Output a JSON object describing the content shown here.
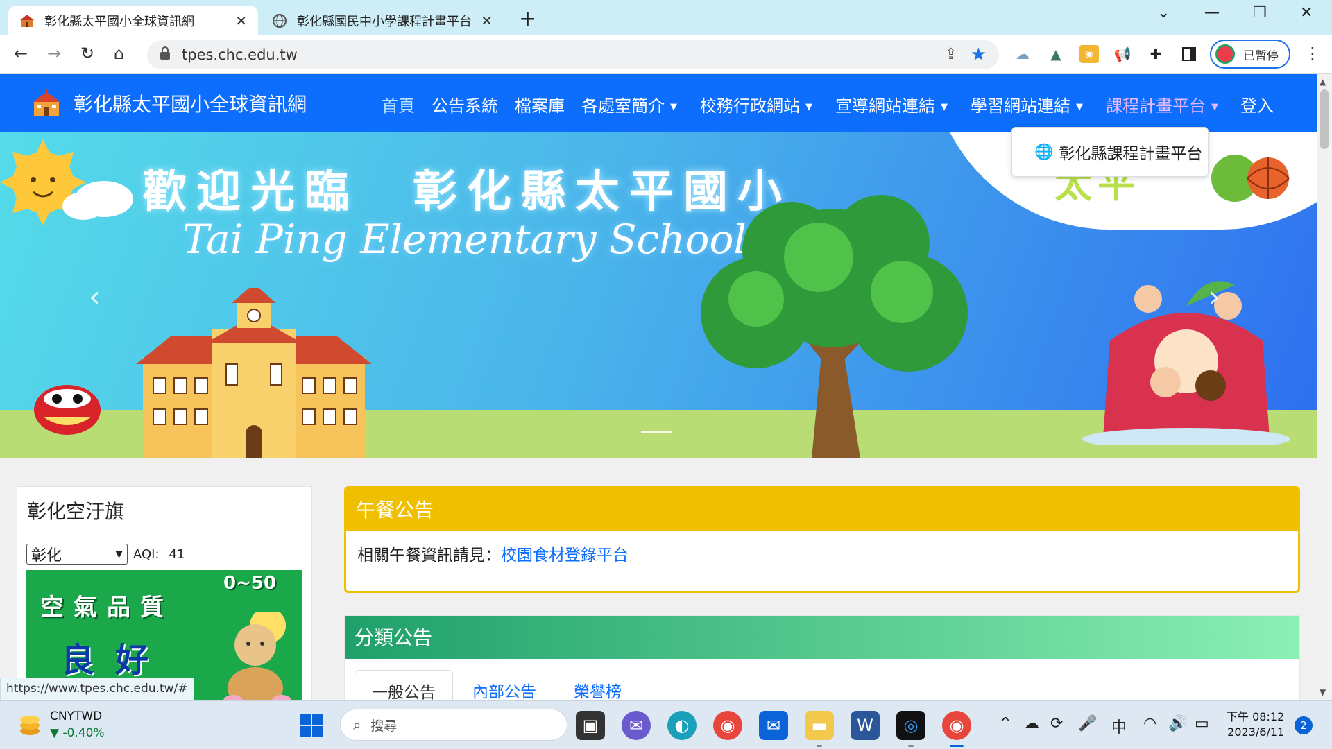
{
  "browser": {
    "tabs": [
      {
        "title": "彰化縣太平國小全球資訊網",
        "active": true,
        "favicon": "school-icon"
      },
      {
        "title": "彰化縣國民中小學課程計畫平台",
        "active": false,
        "favicon": "globe-icon"
      }
    ],
    "address": "tpes.chc.edu.tw",
    "profile_label": "已暫停",
    "status_url": "https://www.tpes.chc.edu.tw/#"
  },
  "site": {
    "brand": "彰化縣太平國小全球資訊網",
    "nav": [
      {
        "label": "首頁",
        "dropdown": false
      },
      {
        "label": "公告系統",
        "dropdown": false
      },
      {
        "label": "檔案庫",
        "dropdown": false
      },
      {
        "label": "各處室簡介",
        "dropdown": true
      },
      {
        "label": "校務行政網站",
        "dropdown": true
      },
      {
        "label": "宣導網站連結",
        "dropdown": true
      },
      {
        "label": "學習網站連結",
        "dropdown": true
      },
      {
        "label": "課程計畫平台",
        "dropdown": true
      },
      {
        "label": "登入",
        "dropdown": false
      }
    ],
    "dropdown_item": "彰化縣課程計畫平台",
    "banner": {
      "welcome": "歡迎光臨　彰化縣太平國小",
      "english": "Tai Ping Elementary School",
      "corner_text": "太平"
    },
    "aqi": {
      "title": "彰化空汙旗",
      "selected_city": "彰化",
      "label": "AQI:",
      "value": "41",
      "flag_quality": "空氣品質",
      "flag_grade": "良好",
      "flag_range": "0~50"
    },
    "lunch": {
      "title": "午餐公告",
      "text": "相關午餐資訊請見：",
      "link": "校園食材登錄平台"
    },
    "classified": {
      "title": "分類公告",
      "tabs": [
        "一般公告",
        "內部公告",
        "榮譽榜"
      ]
    }
  },
  "taskbar": {
    "stock_symbol": "CNYTWD",
    "stock_change": "-0.40%",
    "search_placeholder": "搜尋",
    "ime": "中",
    "time": "下午 08:12",
    "date": "2023/6/11",
    "notifications": "2"
  },
  "colors": {
    "site_nav": "#0d6efd",
    "lunch_header": "#f0c000",
    "class_header_start": "#1fa06a",
    "class_header_end": "#8bf0b4"
  }
}
